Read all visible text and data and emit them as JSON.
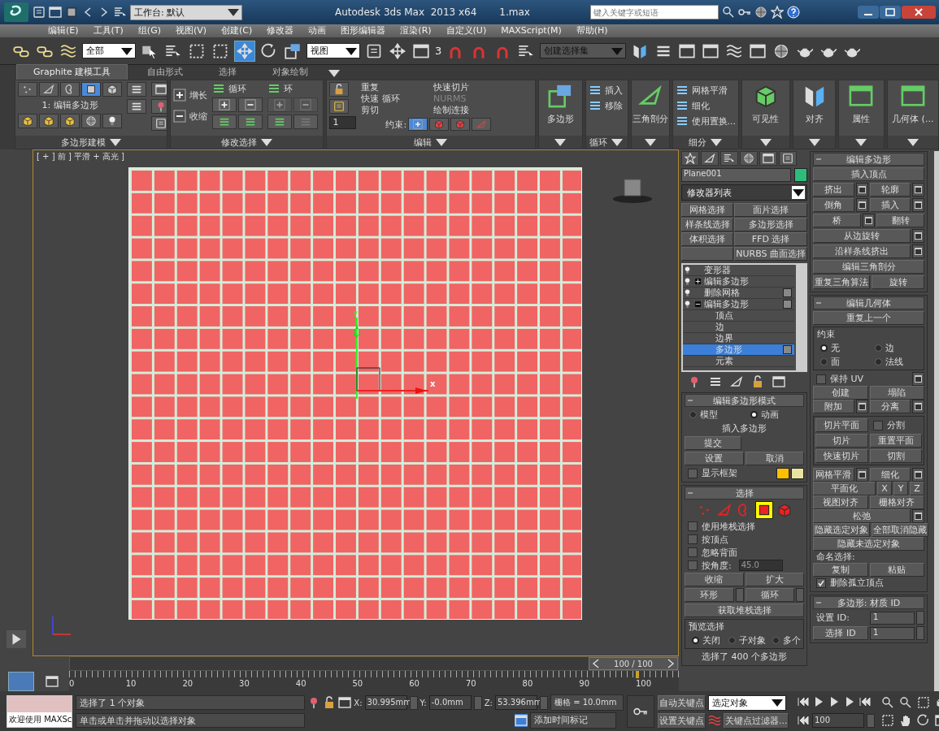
{
  "title_bar": {
    "workspace": "工作台: 默认",
    "title": "Autodesk 3ds Max  2013 x64",
    "file": "1.max",
    "search": {
      "placeholder": "键入关键字或短语"
    }
  },
  "menu": [
    "编辑(E)",
    "工具(T)",
    "组(G)",
    "视图(V)",
    "创建(C)",
    "修改器",
    "动画",
    "图形编辑器",
    "渲染(R)",
    "自定义(U)",
    "MAXScript(M)",
    "帮助(H)"
  ],
  "main_toolbar": {
    "selection_filter": "全部",
    "reference_coord": "视图",
    "snap_label": "3",
    "selection_set": "创建选择集",
    "transform_tools": [
      {
        "kind": "move",
        "selected": true
      },
      {
        "kind": "rotate",
        "selected": false
      },
      {
        "kind": "scale",
        "selected": false
      }
    ]
  },
  "ribbon": {
    "tabs": [
      {
        "label": "Graphite 建模工具",
        "selected": true
      },
      {
        "label": "自由形式",
        "selected": false
      },
      {
        "label": "选择",
        "selected": false
      },
      {
        "label": "对象绘制",
        "selected": false
      }
    ],
    "panels": [
      {
        "kind": "polygon_modeling",
        "title": "多边形建模",
        "label": "1: 编辑多边形",
        "sub_modes": [
          {
            "kind": "vertex",
            "selected": false
          },
          {
            "kind": "edge",
            "selected": false
          },
          {
            "kind": "border",
            "selected": false
          },
          {
            "kind": "polygon",
            "selected": true
          },
          {
            "kind": "element",
            "selected": false
          }
        ]
      },
      {
        "kind": "modify_selection",
        "title": "修改选择",
        "items": [
          "增长",
          "收缩",
          "循环",
          "环"
        ]
      },
      {
        "kind": "edit",
        "title": "编辑",
        "items": [
          {
            "label": "重复",
            "disabled": false
          },
          {
            "label": "快速切片",
            "disabled": false
          },
          {
            "label": "快速 循环",
            "disabled": false
          },
          {
            "label": "NURMS",
            "disabled": true
          },
          {
            "label": "剪切",
            "disabled": false
          },
          {
            "label": "绘制连接",
            "disabled": false
          }
        ],
        "constraint_label": "约束:",
        "spinner": "1",
        "constraints": [
          {
            "kind": "none",
            "selected": true
          },
          {
            "kind": "edge",
            "selected": false
          },
          {
            "kind": "face",
            "selected": false
          },
          {
            "kind": "normal",
            "selected": false
          }
        ]
      },
      {
        "kind": "large",
        "label": "多边形"
      },
      {
        "kind": "list",
        "title": "循环",
        "items": [
          "插入",
          "移除"
        ]
      },
      {
        "kind": "large",
        "label": "三角剖分"
      },
      {
        "kind": "list",
        "title": "细分",
        "items": [
          "网格平滑",
          "细化",
          "使用置换..."
        ]
      },
      {
        "kind": "large",
        "label": "可见性"
      },
      {
        "kind": "large",
        "label": "对齐"
      },
      {
        "kind": "large",
        "label": "属性"
      },
      {
        "kind": "large",
        "label": "几何体 (..."
      }
    ]
  },
  "viewport": {
    "label": "[ + ] 前 ] 平滑 + 高光 ]",
    "gizmo_x": "x",
    "gizmo_y": "y"
  },
  "command_panel": {
    "object_name": "Plane001",
    "modifier_list": "修改器列表",
    "modifier_buttons": [
      {
        "kind": "button",
        "label": "网格选择"
      },
      {
        "kind": "button",
        "label": "面片选择"
      },
      {
        "kind": "button",
        "label": "样条线选择"
      },
      {
        "kind": "button",
        "label": "多边形选择"
      },
      {
        "kind": "button",
        "label": "体积选择"
      },
      {
        "kind": "button",
        "label": "FFD 选择"
      },
      {
        "kind": "blank"
      },
      {
        "kind": "button",
        "label": "NURBS 曲面选择"
      }
    ],
    "stack": [
      {
        "label": "变形器",
        "option_box": false
      },
      {
        "label": "编辑多边形",
        "option_box": false,
        "expanded": false
      },
      {
        "label": "删除网格",
        "option_box": true
      },
      {
        "label": "编辑多边形",
        "option_box": true,
        "expanded": true,
        "children": [
          {
            "label": "顶点",
            "selected": false,
            "option_box": false
          },
          {
            "label": "边",
            "selected": false,
            "option_box": false
          },
          {
            "label": "边界",
            "selected": false,
            "option_box": false
          },
          {
            "label": "多边形",
            "selected": true,
            "option_box": true
          },
          {
            "label": "元素",
            "selected": false,
            "option_box": false
          }
        ]
      }
    ],
    "edit_poly_mode": {
      "title": "编辑多边形模式",
      "modes": [
        {
          "label": "模型",
          "selected": false
        },
        {
          "label": "动画",
          "selected": true
        }
      ],
      "current_op": "插入多边形",
      "commit": "提交",
      "settings": "设置",
      "cancel": "取消",
      "show_cage": {
        "label": "显示框架",
        "checked": false
      },
      "cage_colors": [
        {
          "color": "#ffc000"
        },
        {
          "color": "#e8e4a0"
        }
      ]
    },
    "selection": {
      "title": "选择",
      "levels": [
        {
          "kind": "vertex",
          "selected": false
        },
        {
          "kind": "edge",
          "selected": false
        },
        {
          "kind": "border",
          "selected": false
        },
        {
          "kind": "polygon",
          "selected": true
        },
        {
          "kind": "element",
          "selected": false
        }
      ],
      "options": [
        {
          "label": "使用堆栈选择",
          "checked": false
        },
        {
          "label": "按顶点",
          "checked": false
        },
        {
          "label": "忽略背面",
          "checked": false
        },
        {
          "label": "按角度:",
          "checked": false
        }
      ],
      "angle": "45.0",
      "shrink": "收缩",
      "grow": "扩大",
      "ring": "环形",
      "loop": "循环",
      "get_stack": "获取堆栈选择",
      "preview": {
        "title": "预览选择",
        "options": [
          {
            "label": "关闭",
            "selected": true
          },
          {
            "label": "子对象",
            "selected": false
          },
          {
            "label": "多个",
            "selected": false
          }
        ]
      },
      "summary": "选择了 400 个多边形"
    },
    "edit_polygons": {
      "title": "编辑多边形",
      "rows": [
        [
          {
            "label": "插入顶点",
            "settings": false
          }
        ],
        [
          {
            "label": "挤出",
            "settings": true
          },
          {
            "label": "轮廓",
            "settings": true
          }
        ],
        [
          {
            "label": "倒角",
            "settings": true
          },
          {
            "label": "插入",
            "settings": true
          }
        ],
        [
          {
            "label": "桥",
            "settings": true
          },
          {
            "label": "翻转",
            "settings": false
          }
        ],
        [
          {
            "label": "从边旋转",
            "settings": true
          }
        ],
        [
          {
            "label": "沿样条线挤出",
            "settings": true
          }
        ],
        [
          {
            "label": "编辑三角剖分",
            "settings": false
          }
        ],
        [
          {
            "label": "重复三角算法",
            "settings": false
          },
          {
            "label": "旋转",
            "settings": false
          }
        ]
      ]
    },
    "edit_geometry": {
      "title": "编辑几何体",
      "repeat": "重复上一个",
      "constraints": {
        "title": "约束",
        "options": [
          {
            "label": "无",
            "selected": true
          },
          {
            "label": "边",
            "selected": false
          },
          {
            "label": "面",
            "selected": false
          },
          {
            "label": "法线",
            "selected": false
          }
        ]
      },
      "rows": [
        [
          {
            "kind": "checkbox",
            "label": "保持 UV",
            "checked": false,
            "settings": true
          }
        ],
        [
          {
            "kind": "button",
            "label": "创建",
            "settings": false
          },
          {
            "kind": "button",
            "label": "塌陷",
            "settings": false
          }
        ],
        [
          {
            "kind": "button",
            "label": "附加",
            "settings": true
          },
          {
            "kind": "button",
            "label": "分离",
            "settings": true
          }
        ]
      ],
      "slice_rows": [
        [
          {
            "kind": "button",
            "label": "切片平面",
            "settings": false
          },
          {
            "kind": "checkbox",
            "label": "分割",
            "checked": false,
            "settings": false
          }
        ],
        [
          {
            "kind": "button",
            "label": "切片",
            "settings": false
          },
          {
            "kind": "button",
            "label": "重置平面",
            "settings": false
          }
        ],
        [
          {
            "kind": "button",
            "label": "快速切片",
            "settings": false
          },
          {
            "kind": "button",
            "label": "切割",
            "settings": false
          }
        ]
      ],
      "rows2": [
        [
          {
            "kind": "button",
            "label": "网格平滑",
            "settings": true
          },
          {
            "kind": "button",
            "label": "细化",
            "settings": true
          }
        ],
        [
          {
            "kind": "button",
            "label": "平面化",
            "settings": false
          },
          {
            "kind": "small",
            "label": "X"
          },
          {
            "kind": "small",
            "label": "Y"
          },
          {
            "kind": "small",
            "label": "Z"
          }
        ],
        [
          {
            "kind": "button",
            "label": "视图对齐",
            "settings": false
          },
          {
            "kind": "button",
            "label": "栅格对齐",
            "settings": false
          }
        ],
        [
          {
            "kind": "button",
            "label": "松弛",
            "settings": true
          }
        ],
        [
          {
            "kind": "button",
            "label": "隐藏选定对象",
            "settings": false
          },
          {
            "kind": "button",
            "label": "全部取消隐藏",
            "settings": false
          }
        ],
        [
          {
            "kind": "button",
            "label": "隐藏未选定对象",
            "settings": false
          }
        ],
        [
          {
            "kind": "text",
            "label": "命名选择:"
          }
        ],
        [
          {
            "kind": "button",
            "label": "复制",
            "settings": false
          },
          {
            "kind": "button",
            "label": "粘贴",
            "settings": false
          }
        ],
        [
          {
            "kind": "checkbox",
            "label": "删除孤立顶点",
            "checked": true,
            "settings": false
          }
        ]
      ]
    },
    "material_ids": {
      "title": "多边形: 材质 ID",
      "set_id": {
        "label": "设置 ID:",
        "value": "1"
      },
      "select_id": {
        "label": "选择 ID",
        "value": "1"
      }
    }
  },
  "time_slider": {
    "label": "100 / 100",
    "level": 1
  },
  "track_bar": {
    "ticks": [
      "0",
      "10",
      "20",
      "30",
      "40",
      "50",
      "60",
      "70",
      "80",
      "90",
      "100"
    ]
  },
  "status_bar": {
    "maxscript": "欢迎使用 MAXSc",
    "prompt": "选择了 1 个对象",
    "hint": "单击或单击并拖动以选择对象",
    "coords": [
      {
        "label": "X:",
        "value": "30.995mm"
      },
      {
        "label": "Y:",
        "value": "-0.0mm"
      },
      {
        "label": "Z:",
        "value": "53.396mm"
      }
    ],
    "grid": "栅格 = 10.0mm",
    "add_time_tag": "添加时间标记",
    "auto_key": "自动关键点",
    "set_key": "设置关键点",
    "key_mode": "选定对象",
    "key_filters": "关键点过滤器...",
    "frame": "100"
  }
}
